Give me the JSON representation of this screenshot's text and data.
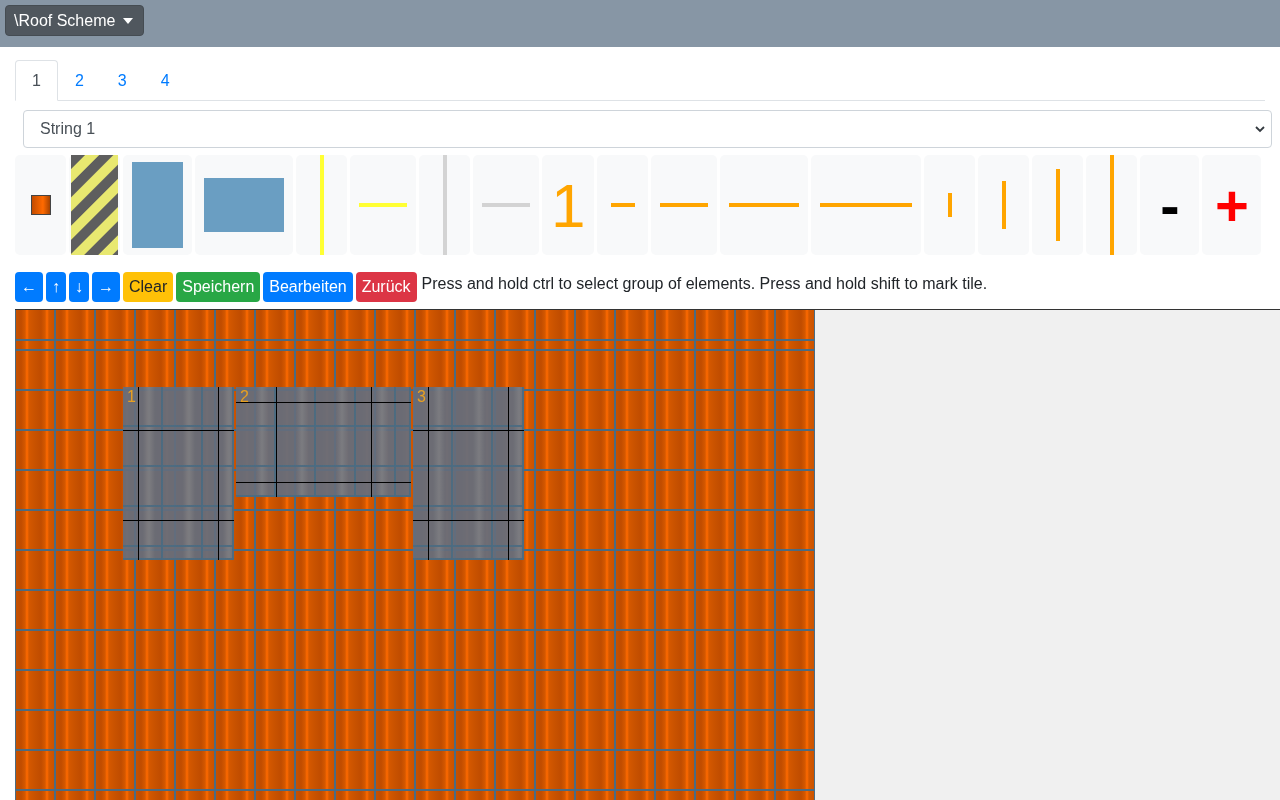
{
  "menu_button": {
    "label": "\\Roof Scheme"
  },
  "tabs": [
    {
      "label": "1",
      "selected": true
    },
    {
      "label": "2",
      "selected": false
    },
    {
      "label": "3",
      "selected": false
    },
    {
      "label": "4",
      "selected": false
    }
  ],
  "string_select": {
    "value": "String 1"
  },
  "palette": [
    {
      "kind": "tile"
    },
    {
      "kind": "hatched"
    },
    {
      "kind": "portrait"
    },
    {
      "kind": "landscape"
    },
    {
      "kind": "vline-full",
      "color": "#ffff33"
    },
    {
      "kind": "hline-medium",
      "color": "#ffff33"
    },
    {
      "kind": "vline-full",
      "color": "#d3d3d3"
    },
    {
      "kind": "hline-medium",
      "color": "#d3d3d3"
    },
    {
      "kind": "text",
      "label": "1",
      "color": "#ffa500"
    },
    {
      "kind": "hline-short",
      "color": "#ffa500"
    },
    {
      "kind": "hline-medium",
      "color": "#ffa500"
    },
    {
      "kind": "hline-long",
      "color": "#ffa500"
    },
    {
      "kind": "hline-full",
      "color": "#ffa500"
    },
    {
      "kind": "vline-short",
      "color": "#ffa500"
    },
    {
      "kind": "vline-medium",
      "color": "#ffa500"
    },
    {
      "kind": "vline-long",
      "color": "#ffa500"
    },
    {
      "kind": "vline-full",
      "color": "#ffa500"
    },
    {
      "kind": "sign",
      "label": "-",
      "color": "#000000"
    },
    {
      "kind": "sign",
      "label": "+",
      "color": "#ff0000"
    }
  ],
  "buttons": [
    {
      "label": "←",
      "kind": "primary"
    },
    {
      "label": "↑",
      "kind": "primary"
    },
    {
      "label": "↓",
      "kind": "primary"
    },
    {
      "label": "→",
      "kind": "primary"
    },
    {
      "label": "Clear",
      "kind": "warning"
    },
    {
      "label": "Speichern",
      "kind": "success"
    },
    {
      "label": "Bearbeiten",
      "kind": "primary"
    },
    {
      "label": "Zurück",
      "kind": "danger"
    }
  ],
  "hint": "Press and hold ctrl to select group of elements. Press and hold shift to mark tile.",
  "roof": {
    "panels": [
      {
        "label": "1",
        "kind": "portrait"
      },
      {
        "label": "2",
        "kind": "landscape"
      },
      {
        "label": "3",
        "kind": "portrait"
      }
    ]
  }
}
